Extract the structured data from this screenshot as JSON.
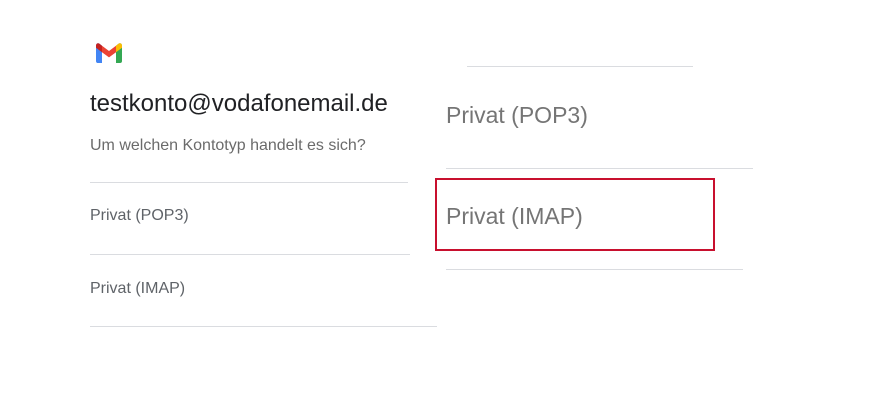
{
  "header": {
    "logo_icon": "gmail-logo-icon",
    "email": "testkonto@vodafonemail.de",
    "question": "Um welchen Kontotyp handelt es sich?"
  },
  "account_types": {
    "pop3_label": "Privat (POP3)",
    "imap_label": "Privat (IMAP)"
  },
  "zoomed_view": {
    "pop3_label": "Privat (POP3)",
    "imap_label": "Privat (IMAP)",
    "highlighted": "imap",
    "highlight_color": "#c8102e"
  }
}
